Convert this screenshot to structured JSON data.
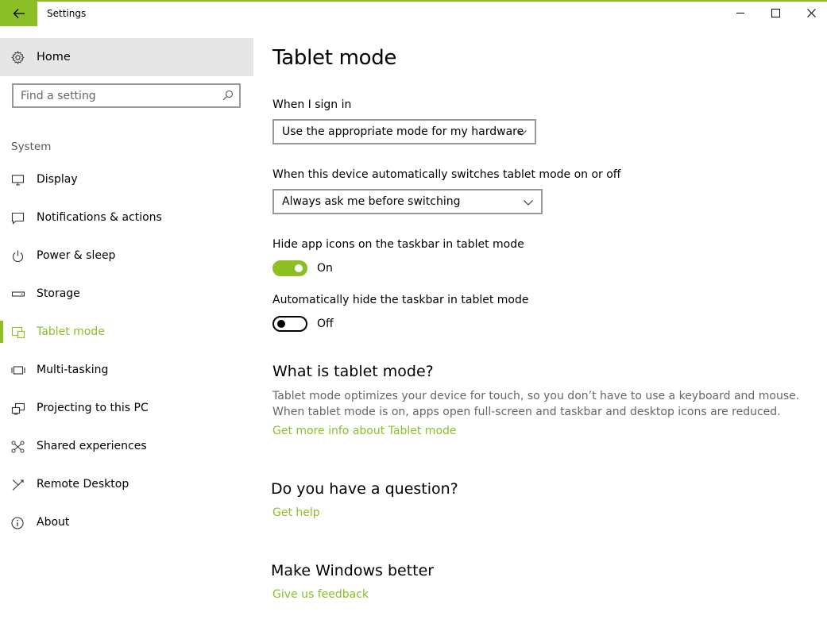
{
  "window": {
    "title": "Settings",
    "accent_color": "#8cbf26",
    "icons": {
      "back": "back-arrow-icon",
      "minimize": "minimize-icon",
      "maximize": "maximize-icon",
      "close": "close-icon"
    }
  },
  "sidebar": {
    "home": {
      "label": "Home",
      "icon": "gear-icon"
    },
    "search": {
      "placeholder": "Find a setting",
      "value": "",
      "icon": "search-icon"
    },
    "section_label": "System",
    "items": [
      {
        "label": "Display",
        "icon": "monitor-icon",
        "active": false
      },
      {
        "label": "Notifications & actions",
        "icon": "message-icon",
        "active": false
      },
      {
        "label": "Power & sleep",
        "icon": "power-icon",
        "active": false
      },
      {
        "label": "Storage",
        "icon": "storage-icon",
        "active": false
      },
      {
        "label": "Tablet mode",
        "icon": "tablet-mode-icon",
        "active": true
      },
      {
        "label": "Multi-tasking",
        "icon": "multitasking-icon",
        "active": false
      },
      {
        "label": "Projecting to this PC",
        "icon": "projecting-icon",
        "active": false
      },
      {
        "label": "Shared experiences",
        "icon": "shared-experiences-icon",
        "active": false
      },
      {
        "label": "Remote Desktop",
        "icon": "remote-desktop-icon",
        "active": false
      },
      {
        "label": "About",
        "icon": "info-icon",
        "active": false
      }
    ]
  },
  "main": {
    "title": "Tablet mode",
    "sign_in": {
      "label": "When I sign in",
      "selected": "Use the appropriate mode for my hardware"
    },
    "auto_switch": {
      "label": "When this device automatically switches tablet mode on or off",
      "selected": "Always ask me before switching"
    },
    "hide_icons": {
      "label": "Hide app icons on the taskbar in tablet mode",
      "state": "On",
      "on": true
    },
    "auto_hide_taskbar": {
      "label": "Automatically hide the taskbar in tablet mode",
      "state": "Off",
      "on": false
    },
    "what_is": {
      "heading": "What is tablet mode?",
      "description": "Tablet mode optimizes your device for touch, so you don’t have to use a keyboard and mouse. When tablet mode is on, apps open full-screen and taskbar and desktop icons are reduced.",
      "link": "Get more info about Tablet mode"
    },
    "question": {
      "heading": "Do you have a question?",
      "link": "Get help"
    },
    "feedback": {
      "heading": "Make Windows better",
      "link": "Give us feedback"
    }
  }
}
